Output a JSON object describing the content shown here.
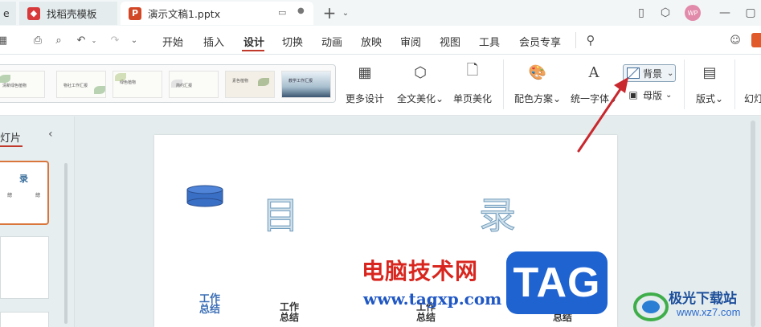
{
  "titlebar": {
    "tabs": [
      {
        "label": "e",
        "state": "inactive"
      },
      {
        "label": "找稻壳模板",
        "state": "inactive"
      },
      {
        "label": "演示文稿1.pptx",
        "state": "active"
      }
    ],
    "new_tab": "+",
    "avatar_initials": "WP"
  },
  "menubar": {
    "items": [
      "开始",
      "插入",
      "设计",
      "切换",
      "动画",
      "放映",
      "审阅",
      "视图",
      "工具",
      "会员专享"
    ],
    "active": "设计"
  },
  "ribbon": {
    "gallery_captions": [
      "清新绿色植物",
      "物社工作汇报",
      "绿色植物",
      "简约汇报",
      "素色植物",
      "教学工作汇报"
    ],
    "buttons": {
      "more_design": "更多设计",
      "beautify_all": "全文美化",
      "single_page": "单页美化",
      "color_scheme": "配色方案",
      "unify_font": "统一字体",
      "background": "背景",
      "master": "母版",
      "layout": "版式",
      "slideshow": "幻灯"
    }
  },
  "left_panel": {
    "title": "幻灯片",
    "thumb1_title": "录",
    "thumb1_items": [
      "總",
      "總"
    ]
  },
  "slide": {
    "title_left": "目",
    "title_right": "录",
    "items": [
      {
        "line1": "工作",
        "line2": "总结"
      },
      {
        "line1": "工作",
        "line2": "总结"
      },
      {
        "line1": "工作",
        "line2": "总结"
      },
      {
        "line1": "工作",
        "line2": "总结"
      }
    ]
  },
  "watermarks": {
    "cn": "电脑技术网",
    "url": "www.tagxp.com",
    "tag": "TAG",
    "site_name": "极光下载站",
    "site_url": "www.xz7.com"
  },
  "colors": {
    "accent": "#c0392b",
    "selection": "#d9763c",
    "arrow": "#c8282e",
    "tag_blue": "#1f63d1"
  }
}
